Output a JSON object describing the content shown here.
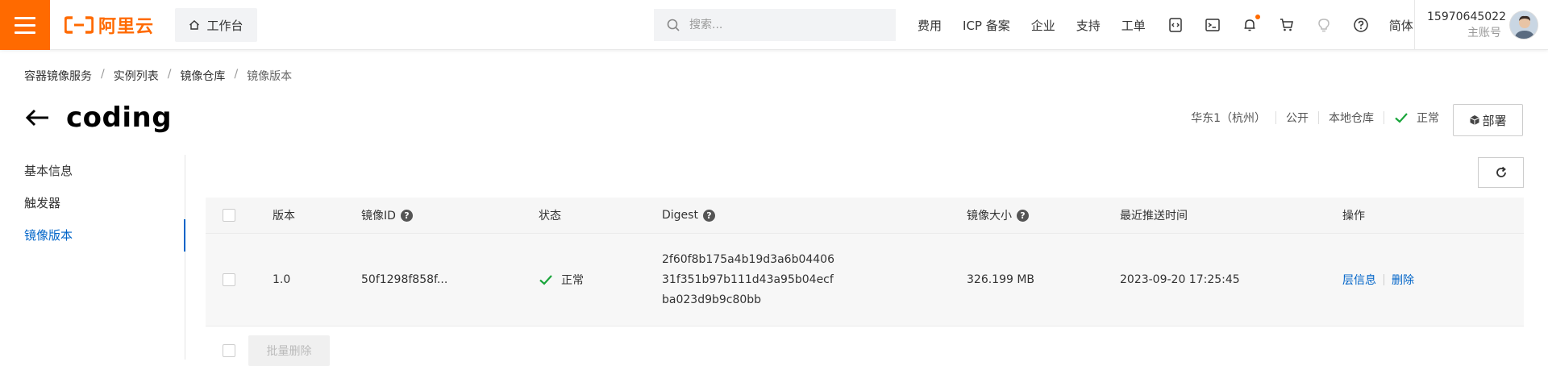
{
  "colors": {
    "brand": "#ff6a00",
    "link": "#0064c8",
    "success": "#1aa53b"
  },
  "topbar": {
    "logo_text": "阿里云",
    "workbench_label": "工作台",
    "search_placeholder": "搜索...",
    "nav_links": [
      "费用",
      "ICP 备案",
      "企业",
      "支持",
      "工单"
    ],
    "icons": [
      "code-icon",
      "terminal-icon",
      "bell-icon",
      "cart-icon",
      "lightbulb-icon",
      "help-icon"
    ],
    "language": "简体",
    "account_id": "15970645022",
    "account_type": "主账号"
  },
  "breadcrumb": [
    "容器镜像服务",
    "实例列表",
    "镜像仓库",
    "镜像版本"
  ],
  "page": {
    "title": "coding",
    "region": "华东1（杭州）",
    "visibility": "公开",
    "repo_type": "本地仓库",
    "status": "正常",
    "deploy_label": "部署"
  },
  "sidemenu": {
    "items": [
      "基本信息",
      "触发器",
      "镜像版本"
    ],
    "active_index": 2
  },
  "table": {
    "headers": {
      "version": "版本",
      "image_id": "镜像ID",
      "status": "状态",
      "digest": "Digest",
      "size": "镜像大小",
      "push_time": "最近推送时间",
      "ops": "操作"
    },
    "rows": [
      {
        "version": "1.0",
        "image_id": "50f1298f858f...",
        "status": "正常",
        "digest_lines": [
          "2f60f8b175a4b19d3a6b04406",
          "31f351b97b111d43a95b04ecf",
          "ba023d9b9c80bb"
        ],
        "size": "326.199 MB",
        "push_time": "2023-09-20 17:25:45",
        "op_layer": "层信息",
        "op_delete": "删除"
      }
    ],
    "batch_delete_label": "批量删除"
  }
}
